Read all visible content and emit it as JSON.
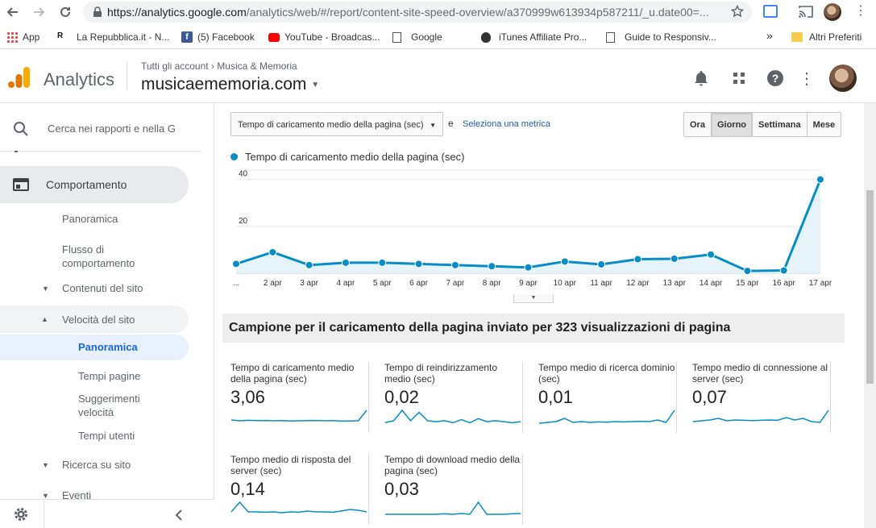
{
  "browser": {
    "url_host": "https://analytics.google.com",
    "url_path": "/analytics/web/#/report/content-site-speed-overview/a370999w613934p587211/_u.date00=...",
    "bookmarks": [
      {
        "label": "App",
        "icon": "apps-grid-icon"
      },
      {
        "label": "La Repubblica.it - N...",
        "icon": "repubblica-icon"
      },
      {
        "label": "(5) Facebook",
        "icon": "facebook-icon"
      },
      {
        "label": "YouTube - Broadcas...",
        "icon": "youtube-icon"
      },
      {
        "label": "Google",
        "icon": "page-icon"
      },
      {
        "label": "iTunes Affiliate Pro...",
        "icon": "apple-icon"
      },
      {
        "label": "Guide to Responsiv...",
        "icon": "page-icon"
      }
    ],
    "more": "»",
    "other_bookmarks": "Altri Preferiti"
  },
  "header": {
    "app_name": "Analytics",
    "breadcrumb_root": "Tutti gli account",
    "breadcrumb_sep": "›",
    "breadcrumb_account": "Musica & Memoria",
    "property": "musicaememoria.com"
  },
  "sidebar": {
    "search_placeholder": "Cerca nei rapporti e nella G",
    "section": "Comportamento",
    "items": {
      "panoramica": "Panoramica",
      "flusso": "Flusso di comportamento",
      "contenuti": "Contenuti del sito",
      "velocita": "Velocità del sito",
      "vel_panoramica": "Panoramica",
      "tempi_pagine": "Tempi pagine",
      "suggerimenti": "Suggerimenti velocità",
      "tempi_utenti": "Tempi utenti",
      "ricerca": "Ricerca su sito",
      "eventi": "Eventi"
    }
  },
  "controls": {
    "metric_selected": "Tempo di caricamento medio della pagina (sec)",
    "and": "e",
    "select_metric_link": "Seleziona una metrica",
    "periods": [
      "Ora",
      "Giorno",
      "Settimana",
      "Mese"
    ],
    "active_period": "Giorno"
  },
  "chart_data": {
    "type": "line",
    "series": [
      {
        "name": "Tempo di caricamento medio della pagina (sec)",
        "color": "#058dc7",
        "values": [
          4,
          9,
          3.5,
          4.5,
          4.5,
          4,
          3.5,
          3,
          2.5,
          5,
          3.8,
          6,
          6.2,
          8,
          1,
          1.2,
          40
        ]
      }
    ],
    "x": [
      "...",
      "2 apr",
      "3 apr",
      "4 apr",
      "5 apr",
      "6 apr",
      "7 apr",
      "8 apr",
      "9 apr",
      "10 apr",
      "11 apr",
      "12 apr",
      "13 apr",
      "14 apr",
      "15 apr",
      "16 apr",
      "17 apr"
    ],
    "y_ticks": [
      "20",
      "40"
    ],
    "ylim": [
      0,
      44
    ]
  },
  "sample_summary": "Campione per il caricamento della pagina inviato per 323 visualizzazioni di pagina",
  "scorecards": [
    {
      "title": "Tempo di caricamento medio della pagina (sec)",
      "value": "3,06",
      "spark": [
        3,
        2.5,
        2.8,
        2.6,
        2.7,
        2.5,
        2.6,
        2.4,
        2.5,
        2.6,
        2.7,
        2.5,
        2.6,
        2.3,
        2.4,
        2.5,
        9
      ]
    },
    {
      "title": "Tempo di reindirizzamento medio (sec)",
      "value": "0,02",
      "spark": [
        1,
        2,
        7,
        2,
        6,
        2,
        1.5,
        2,
        1,
        2.5,
        1,
        3,
        1.5,
        2,
        1.5,
        1,
        1.5
      ]
    },
    {
      "title": "Tempo medio di ricerca dominio (sec)",
      "value": "0,01",
      "spark": [
        1,
        1.5,
        2,
        4,
        1.5,
        2,
        1.5,
        1.8,
        1.6,
        2,
        1.8,
        2,
        2.2,
        2,
        3,
        1.5,
        9
      ]
    },
    {
      "title": "Tempo medio di connessione al server (sec)",
      "value": "0,07",
      "spark": [
        2,
        2.5,
        3,
        4,
        2.5,
        3,
        2.8,
        2.6,
        2.8,
        3,
        2.8,
        4.5,
        3,
        4,
        2,
        1.5,
        9
      ]
    },
    {
      "title": "Tempo medio di risposta del server (sec)",
      "value": "0,14",
      "spark": [
        3,
        9,
        3,
        3,
        2.8,
        3,
        2.5,
        3,
        2.8,
        3.5,
        3,
        3,
        2.8,
        3.5,
        4.5,
        4,
        3
      ]
    },
    {
      "title": "Tempo di download medio della pagina (sec)",
      "value": "0,03",
      "spark": [
        1.5,
        1.5,
        1.5,
        1.5,
        1.5,
        1.5,
        1.5,
        1.8,
        1.5,
        2,
        1.5,
        9,
        1.5,
        1.5,
        1.5,
        1.8,
        2
      ]
    }
  ]
}
